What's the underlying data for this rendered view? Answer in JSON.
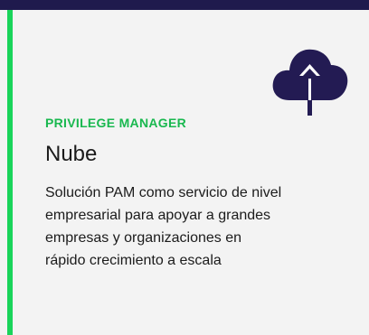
{
  "card": {
    "eyebrow": "PRIVILEGE MANAGER",
    "title": "Nube",
    "description_lines": [
      "Solución PAM como servicio de nivel",
      "empresarial para apoyar a grandes",
      "empresas y organizaciones en",
      "rápido crecimiento a escala"
    ],
    "icon": "cloud-upload-icon"
  },
  "colors": {
    "top_bar": "#1f1a4d",
    "accent": "#19d45a",
    "eyebrow": "#19b84f",
    "icon": "#231b53",
    "background": "#f3f3f3"
  }
}
